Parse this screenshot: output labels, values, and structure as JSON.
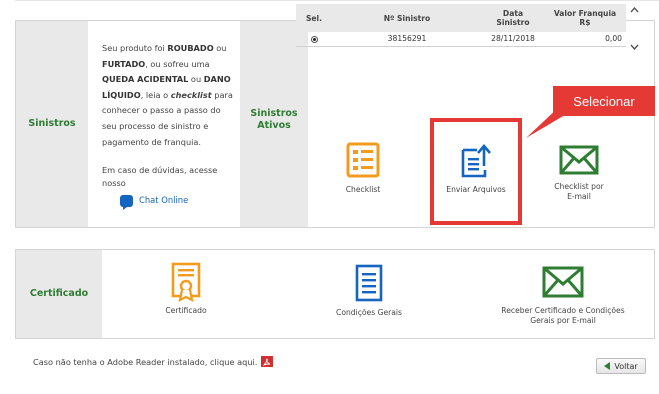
{
  "sinistros": {
    "label": "Sinistros",
    "info_lines": [
      {
        "parts": [
          {
            "t": "Seu produto foi ",
            "s": "n"
          },
          {
            "t": "ROUBADO",
            "s": "b"
          },
          {
            "t": " ou",
            "s": "n"
          }
        ]
      },
      {
        "parts": [
          {
            "t": "FURTADO",
            "s": "b"
          },
          {
            "t": ", ou sofreu uma",
            "s": "n"
          }
        ]
      },
      {
        "parts": [
          {
            "t": "QUEDA ACIDENTAL",
            "s": "b"
          },
          {
            "t": " ou ",
            "s": "n"
          },
          {
            "t": "DANO",
            "s": "b"
          }
        ]
      },
      {
        "parts": [
          {
            "t": "LÍQUIDO",
            "s": "b"
          },
          {
            "t": ", leia o ",
            "s": "n"
          },
          {
            "t": "checklist",
            "s": "i"
          },
          {
            "t": " para",
            "s": "n"
          }
        ]
      },
      {
        "parts": [
          {
            "t": "conhecer o passo a passo do",
            "s": "n"
          }
        ]
      },
      {
        "parts": [
          {
            "t": "seu processo de sinistro e",
            "s": "n"
          }
        ]
      },
      {
        "parts": [
          {
            "t": "pagamento de franquia.",
            "s": "n"
          }
        ]
      }
    ],
    "duvidas_line1": "Em caso de dúvidas, acesse",
    "duvidas_line2": "nosso",
    "chat_label": "Chat Online",
    "ativos_label_1": "Sinistros",
    "ativos_label_2": "Ativos"
  },
  "table": {
    "headers": [
      "Sel.",
      "Nº Sinistro",
      "Data Sinistro",
      "Valor Franquia R$"
    ],
    "header_lines": [
      [
        "Sel."
      ],
      [
        "Nº Sinistro"
      ],
      [
        "Data",
        "Sinistro"
      ],
      [
        "Valor Franquia",
        "R$"
      ]
    ],
    "rows": [
      {
        "selected": true,
        "numero": "38156291",
        "data": "28/11/2018",
        "valor": "0,00"
      }
    ]
  },
  "actions": {
    "checklist": "Checklist",
    "enviar": "Enviar Arquivos",
    "checklist_email_1": "Checklist por",
    "checklist_email_2": "E-mail"
  },
  "callout": {
    "label": "Selecionar"
  },
  "certificado": {
    "label": "Certificado",
    "item_certificado": "Certificado",
    "item_condicoes": "Condições Gerais",
    "item_receber_1": "Receber Certificado e Condições",
    "item_receber_2": "Gerais por E-mail"
  },
  "footer": {
    "adobe_text": "Caso não tenha o Adobe Reader instalado, clique aqui.",
    "voltar": "Voltar"
  },
  "colors": {
    "accent_green": "#2e7d32",
    "highlight_red": "#e53935",
    "icon_orange": "#f29b1f",
    "icon_blue": "#1565c0"
  }
}
